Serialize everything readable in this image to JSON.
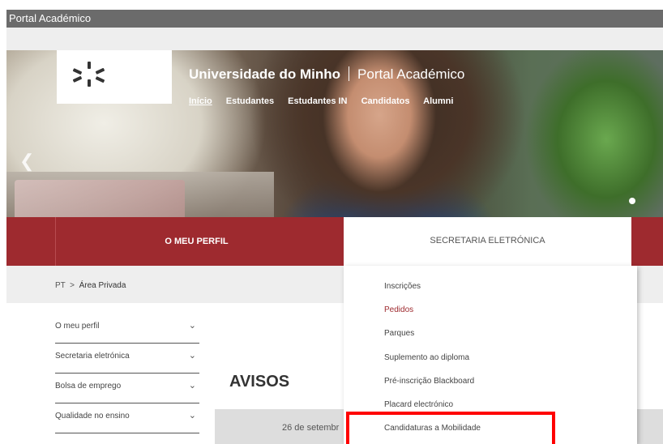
{
  "window": {
    "title": "Portal Académico"
  },
  "header": {
    "university": "Universidade do Minho",
    "portal": "Portal Académico",
    "nav": [
      "Início",
      "Estudantes",
      "Estudantes IN",
      "Candidatos",
      "Alumni"
    ]
  },
  "tabs": {
    "perfil": "O MEU PERFIL",
    "secretaria": "SECRETARIA ELETRÓNICA"
  },
  "breadcrumb": {
    "root": "PT",
    "sep": ">",
    "current": "Área Privada"
  },
  "sidebar": {
    "items": [
      {
        "label": "O meu perfil"
      },
      {
        "label": "Secretaria eletrónica"
      },
      {
        "label": "Bolsa de emprego"
      },
      {
        "label": "Qualidade no ensino"
      }
    ]
  },
  "main": {
    "heading": "AVISOS",
    "date": "26 de setembr"
  },
  "dropdown": {
    "items": [
      {
        "label": "Inscrições"
      },
      {
        "label": "Pedidos"
      },
      {
        "label": "Parques"
      },
      {
        "label": "Suplemento ao diploma"
      },
      {
        "label": "Pré-inscrição Blackboard"
      },
      {
        "label": "Placard electrónico"
      },
      {
        "label": "Candidaturas a Mobilidade"
      }
    ],
    "selected": "Pedidos"
  },
  "colors": {
    "brand": "#9e2a2f",
    "highlight": "#ff0000"
  }
}
